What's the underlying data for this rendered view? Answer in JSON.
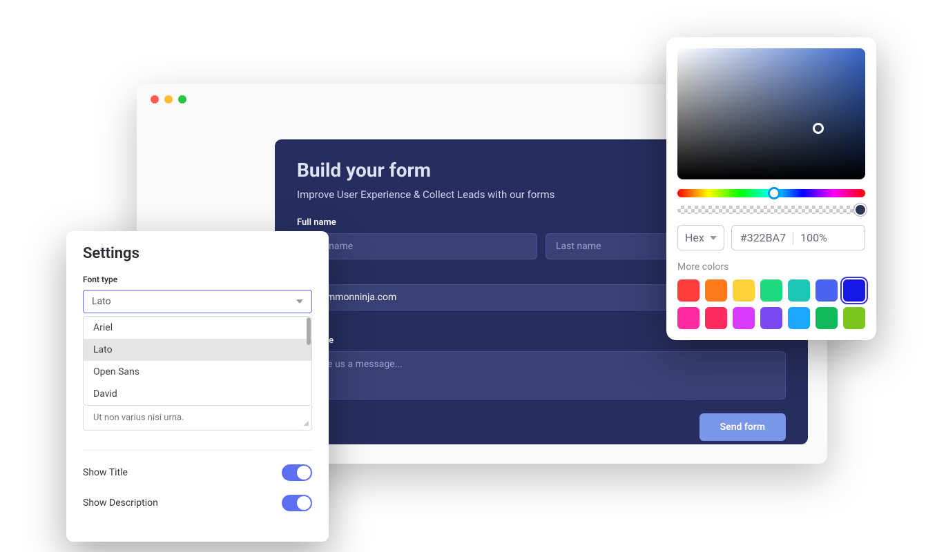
{
  "form": {
    "title": "Build your form",
    "subtitle": "Improve User Experience & Collect Leads with our forms",
    "fullname_label": "Full name",
    "first_name_placeholder": "First name",
    "last_name_placeholder": "Last name",
    "email_value": "@commonninja.com",
    "message_label": "Message",
    "message_placeholder": "Leave us a message...",
    "send_label": "Send form"
  },
  "settings": {
    "title": "Settings",
    "font_type_label": "Font type",
    "font_selected": "Lato",
    "font_options": [
      "Ariel",
      "Lato",
      "Open Sans",
      "David"
    ],
    "extra_text": "Ut non varius nisi urna.",
    "show_title_label": "Show Title",
    "show_title_value": true,
    "show_description_label": "Show Description",
    "show_description_value": true
  },
  "color_picker": {
    "format": "Hex",
    "hex_value": "#322BA7",
    "alpha_value": "100%",
    "more_colors_label": "More colors",
    "swatches_row1": [
      "#ff3b3b",
      "#ff7a1a",
      "#ffd23b",
      "#1ed97e",
      "#1ec7b5",
      "#4a63f0",
      "#1818e6"
    ],
    "swatches_row2": [
      "#ff2aa0",
      "#ff2a5e",
      "#d83bff",
      "#7a4af0",
      "#1ea5ff",
      "#14b85c",
      "#7ac61e"
    ],
    "active_swatch_index": 6
  }
}
